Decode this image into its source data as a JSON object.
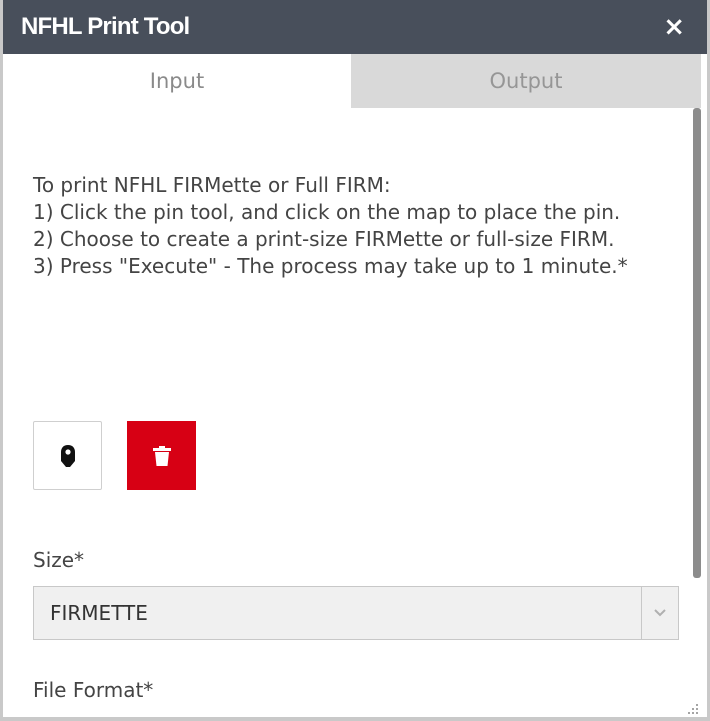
{
  "header": {
    "title": "NFHL Print Tool",
    "close_label": "×"
  },
  "tabs": [
    {
      "label": "Input",
      "active": true
    },
    {
      "label": "Output",
      "active": false
    }
  ],
  "instructions": [
    "To print NFHL FIRMette or Full FIRM:",
    "1) Click the pin tool, and click on the map to place the pin.",
    "2) Choose to create a print-size FIRMette or full-size FIRM.",
    "3) Press \"Execute\" - The process may take up to 1 minute.*"
  ],
  "tools": {
    "pin_icon": "map-pin-icon",
    "delete_icon": "trash-icon",
    "delete_color": "#d70014"
  },
  "size_field": {
    "label": "Size*",
    "value": "FIRMETTE"
  },
  "format_field": {
    "label": "File Format*"
  },
  "colors": {
    "header_bg": "#484f5b",
    "inactive_tab_bg": "#d9d9d9"
  }
}
